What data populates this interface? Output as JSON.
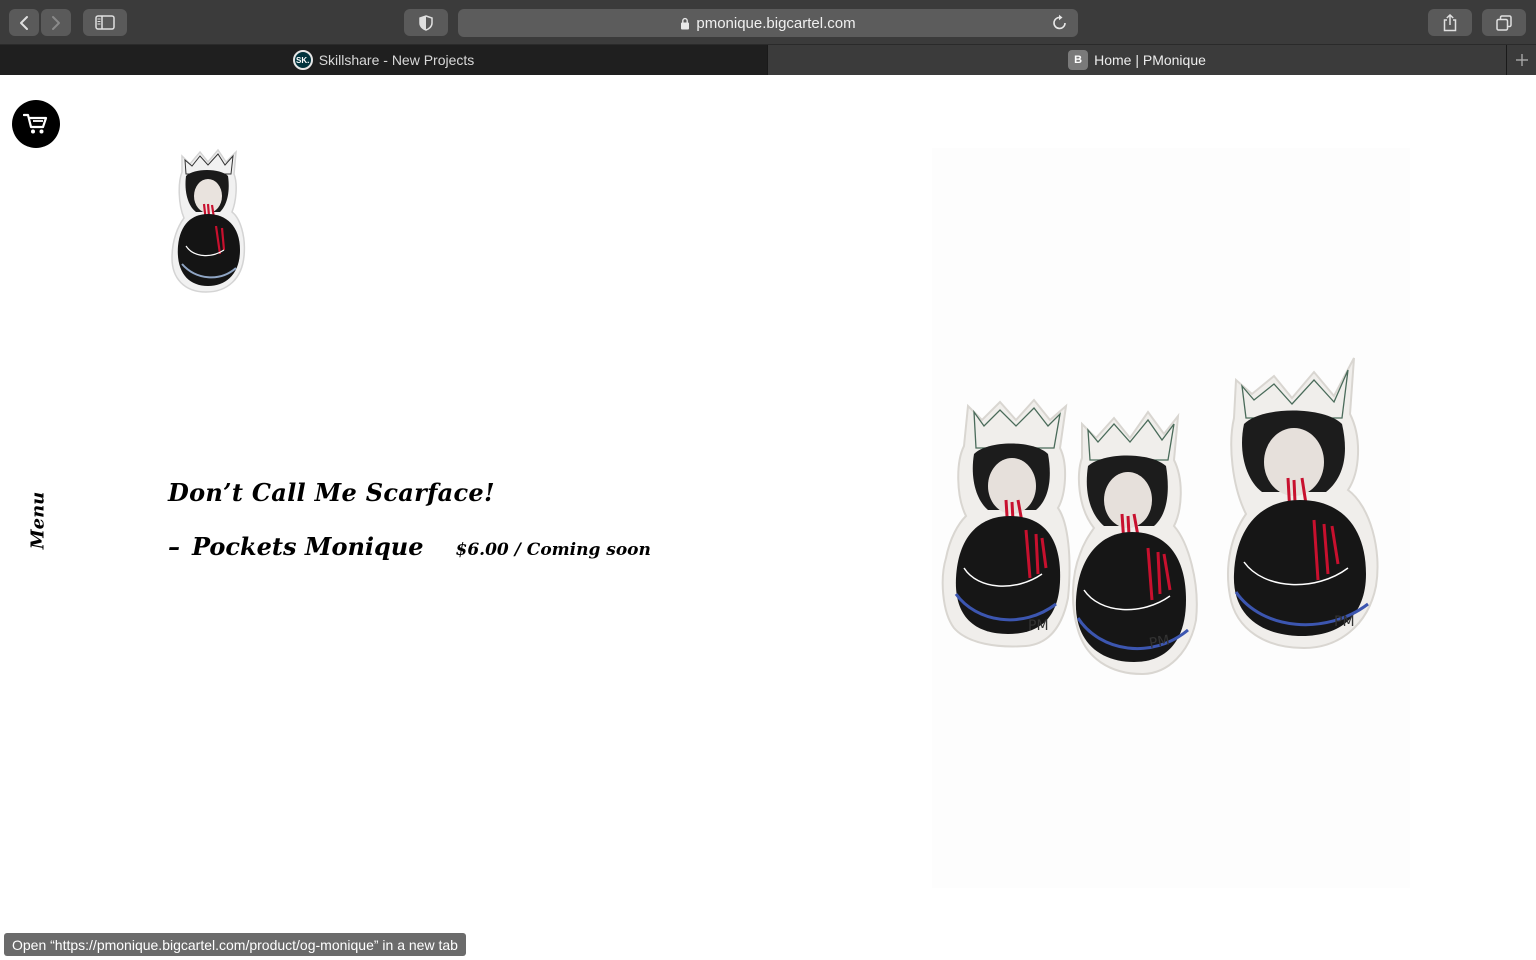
{
  "browser": {
    "url": "pmonique.bigcartel.com",
    "tabs": [
      {
        "label": "Skillshare - New Projects",
        "favicon_text": "SK.",
        "active": false
      },
      {
        "label": "Home | PMonique",
        "favicon_text": "B",
        "active": true
      }
    ],
    "status_tooltip": "Open “https://pmonique.bigcartel.com/product/og-monique” in a new tab"
  },
  "page": {
    "menu_label": "Menu",
    "product": {
      "title": "Don’t Call Me Scarface!",
      "dash": "–",
      "artist": "Pockets Monique",
      "price_status": "$6.00 / Coming soon",
      "sticker_signature": "PM"
    }
  },
  "icons": {
    "back": "chevron-left-icon",
    "forward": "chevron-right-icon",
    "sidebar": "sidebar-icon",
    "privacy": "shield-icon",
    "lock": "lock-icon",
    "reload": "reload-icon",
    "share": "share-icon",
    "tabs": "tabs-icon",
    "new_tab": "plus-icon",
    "cart": "cart-icon"
  },
  "colors": {
    "toolbar": "#3b3b3b",
    "tabbar": "#2b2b2b",
    "page_background": "#ffffff",
    "cart_button": "#000000",
    "sticker_blood": "#c8102e"
  }
}
